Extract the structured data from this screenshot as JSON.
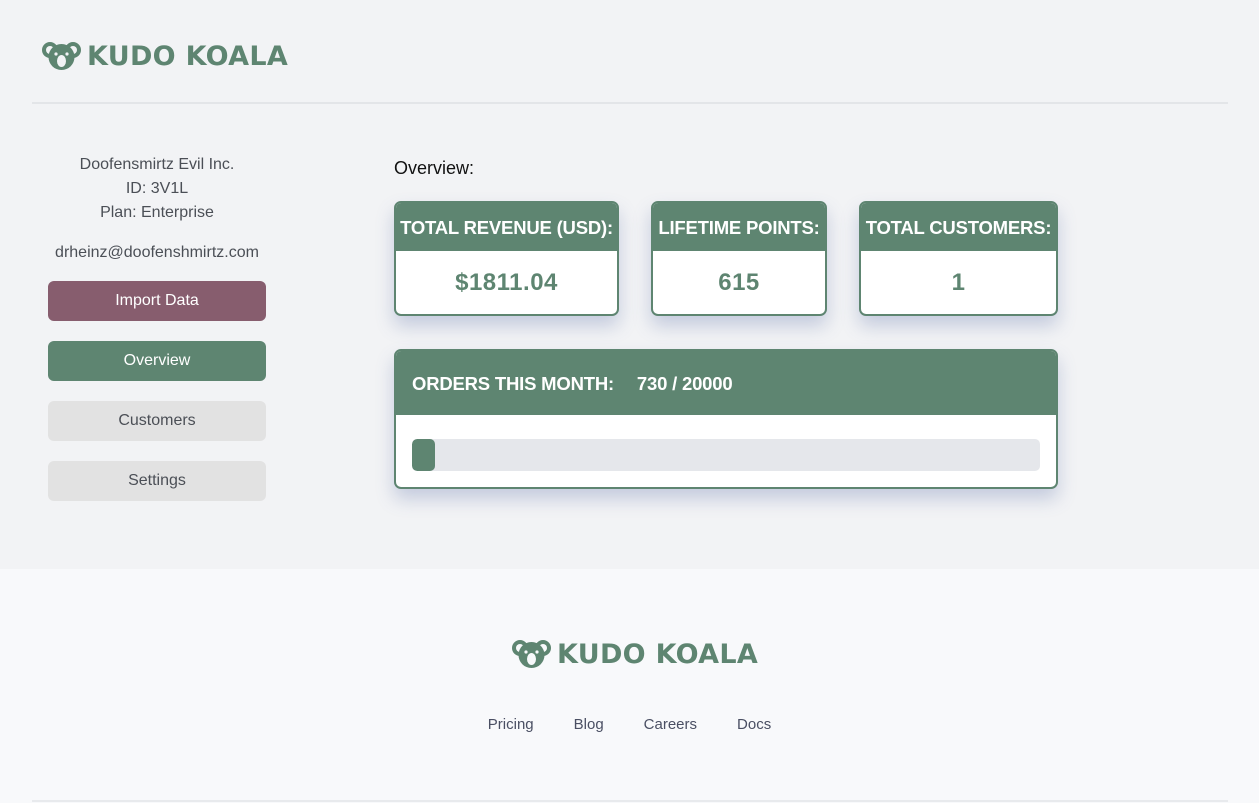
{
  "brand": {
    "name": "KUDO KOALA",
    "color": "#5e8571",
    "logo_icon": "koala-icon"
  },
  "sidebar": {
    "company": "Doofensmirtz Evil Inc.",
    "id_line": "ID: 3V1L",
    "plan_line": "Plan: Enterprise",
    "email": "drheinz@doofenshmirtz.com",
    "import_label": "Import Data",
    "nav": [
      {
        "label": "Overview",
        "active": true
      },
      {
        "label": "Customers",
        "active": false
      },
      {
        "label": "Settings",
        "active": false
      }
    ]
  },
  "main": {
    "title": "Overview:",
    "cards": [
      {
        "label": "TOTAL REVENUE (USD):",
        "value": "$1811.04"
      },
      {
        "label": "LIFETIME POINTS:",
        "value": "615"
      },
      {
        "label": "TOTAL CUSTOMERS:",
        "value": "1"
      }
    ],
    "orders": {
      "label": "ORDERS THIS MONTH:",
      "value": "730 / 20000",
      "used": 730,
      "limit": 20000
    }
  },
  "footer": {
    "links": [
      "Pricing",
      "Blog",
      "Careers",
      "Docs"
    ]
  },
  "colors": {
    "accent": "#5e8571",
    "import_button": "#875d6e",
    "muted_button": "#e2e2e2"
  }
}
